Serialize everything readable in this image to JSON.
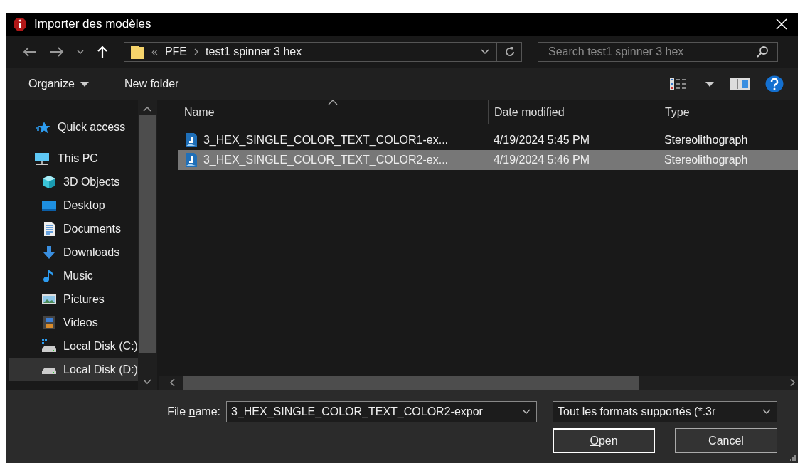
{
  "window": {
    "title": "Importer des modèles"
  },
  "address": {
    "overflow": "«",
    "path": [
      "PFE",
      "test1 spinner 3 hex"
    ]
  },
  "search": {
    "placeholder": "Search test1 spinner 3 hex"
  },
  "toolbar": {
    "organize": "Organize",
    "new_folder": "New folder"
  },
  "sidebar": {
    "items": [
      {
        "label": "Quick access",
        "kind": "star",
        "selected": false
      },
      {
        "label": "This PC",
        "kind": "pc",
        "selected": false,
        "children": [
          {
            "label": "3D Objects",
            "kind": "cube",
            "selected": false
          },
          {
            "label": "Desktop",
            "kind": "desktop",
            "selected": false
          },
          {
            "label": "Documents",
            "kind": "documents",
            "selected": false
          },
          {
            "label": "Downloads",
            "kind": "downloads",
            "selected": false
          },
          {
            "label": "Music",
            "kind": "music",
            "selected": false
          },
          {
            "label": "Pictures",
            "kind": "pictures",
            "selected": false
          },
          {
            "label": "Videos",
            "kind": "videos",
            "selected": false
          },
          {
            "label": "Local Disk (C:)",
            "kind": "system_disk",
            "selected": false
          },
          {
            "label": "Local Disk (D:)",
            "kind": "disk",
            "selected": true
          }
        ]
      }
    ]
  },
  "file_list": {
    "columns": [
      {
        "label": "Name",
        "sorted": true
      },
      {
        "label": "Date modified",
        "sorted": false
      },
      {
        "label": "Type",
        "sorted": false
      }
    ],
    "rows": [
      {
        "name": "3_HEX_SINGLE_COLOR_TEXT_COLOR1-ex...",
        "date": "4/19/2024 5:45 PM",
        "type": "Stereolithograph",
        "selected": false
      },
      {
        "name": "3_HEX_SINGLE_COLOR_TEXT_COLOR2-ex...",
        "date": "4/19/2024 5:46 PM",
        "type": "Stereolithograph",
        "selected": true
      }
    ]
  },
  "footer": {
    "file_name_label": [
      {
        "text": "File ",
        "underlined": false
      },
      {
        "text": "n",
        "underlined": true
      },
      {
        "text": "ame:",
        "underlined": false
      }
    ],
    "file_name": "3_HEX_SINGLE_COLOR_TEXT_COLOR2-expor",
    "file_type": "Tout les formats supportés (*.3r",
    "buttons": [
      {
        "label": [
          {
            "text": "O",
            "underlined": true
          },
          {
            "text": "pen",
            "underlined": false
          }
        ],
        "default": true
      },
      {
        "label": [
          {
            "text": "Cancel",
            "underlined": false
          }
        ],
        "default": false
      }
    ]
  }
}
